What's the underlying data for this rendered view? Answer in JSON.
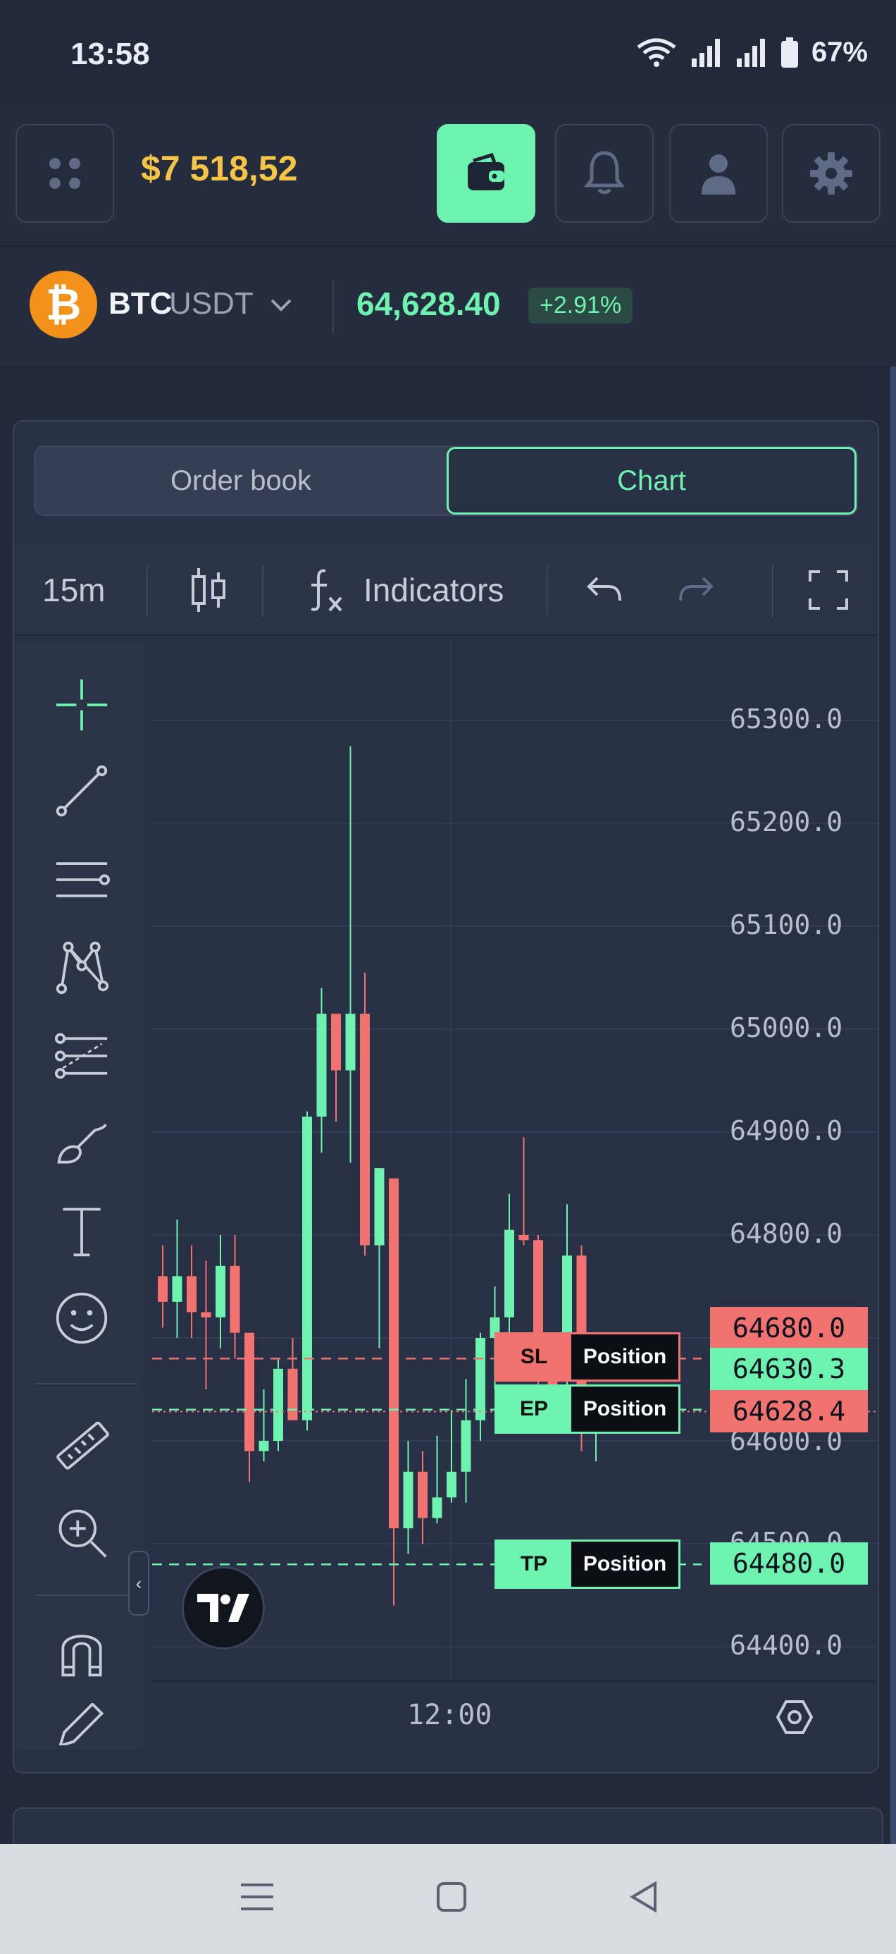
{
  "status_bar": {
    "time": "13:58",
    "battery": "67%"
  },
  "header": {
    "balance": "$7 518,52"
  },
  "ticker": {
    "base": "BTC",
    "quote": "USDT",
    "price": "64,628.40",
    "change": "+2.91%"
  },
  "tabs": {
    "order_book": "Order book",
    "chart": "Chart",
    "active": "Chart"
  },
  "chart_toolbar": {
    "interval": "15m",
    "indicators": "Indicators"
  },
  "position_tags": {
    "sl": {
      "key": "SL",
      "label": "Position"
    },
    "ep": {
      "key": "EP",
      "label": "Position"
    },
    "tp": {
      "key": "TP",
      "label": "Position"
    }
  },
  "price_labels": {
    "sl": "64680.0",
    "ep": "64630.3",
    "last": "64628.4",
    "tp": "64480.0"
  },
  "chart_data": {
    "type": "candlestick",
    "y_ticks": [
      "65300.0",
      "65200.0",
      "65100.0",
      "65000.0",
      "64900.0",
      "64800.0",
      "64600.0",
      "64500.0",
      "64400.0"
    ],
    "x_ticks": [
      "12:00"
    ],
    "levels": {
      "sl": 64680.0,
      "ep": 64630.3,
      "last": 64628.4,
      "tp": 64480.0
    },
    "ohlc": [
      [
        64760,
        64790,
        64710,
        64735
      ],
      [
        64735,
        64815,
        64700,
        64760
      ],
      [
        64760,
        64790,
        64700,
        64725
      ],
      [
        64725,
        64775,
        64650,
        64720
      ],
      [
        64720,
        64800,
        64690,
        64770
      ],
      [
        64770,
        64800,
        64680,
        64705
      ],
      [
        64705,
        64705,
        64560,
        64590
      ],
      [
        64590,
        64650,
        64580,
        64600
      ],
      [
        64600,
        64680,
        64590,
        64670
      ],
      [
        64670,
        64700,
        64630,
        64620
      ],
      [
        64620,
        64920,
        64610,
        64915
      ],
      [
        64915,
        65040,
        64880,
        65015
      ],
      [
        65015,
        65015,
        64910,
        64960
      ],
      [
        64960,
        65275,
        64870,
        65015
      ],
      [
        65015,
        65055,
        64780,
        64790
      ],
      [
        64790,
        64860,
        64690,
        64865
      ],
      [
        64855,
        64855,
        64440,
        64515
      ],
      [
        64515,
        64600,
        64490,
        64570
      ],
      [
        64570,
        64590,
        64500,
        64525
      ],
      [
        64525,
        64605,
        64520,
        64545
      ],
      [
        64545,
        64630,
        64540,
        64570
      ],
      [
        64570,
        64660,
        64540,
        64620
      ],
      [
        64620,
        64705,
        64600,
        64700
      ],
      [
        64700,
        64750,
        64650,
        64720
      ],
      [
        64720,
        64840,
        64690,
        64805
      ],
      [
        64800,
        64895,
        64790,
        64795
      ],
      [
        64795,
        64800,
        64640,
        64690
      ],
      [
        64690,
        64700,
        64620,
        64630
      ],
      [
        64700,
        64830,
        64640,
        64780
      ],
      [
        64780,
        64790,
        64590,
        64612
      ],
      [
        64612,
        64620,
        64580,
        64628
      ]
    ]
  }
}
